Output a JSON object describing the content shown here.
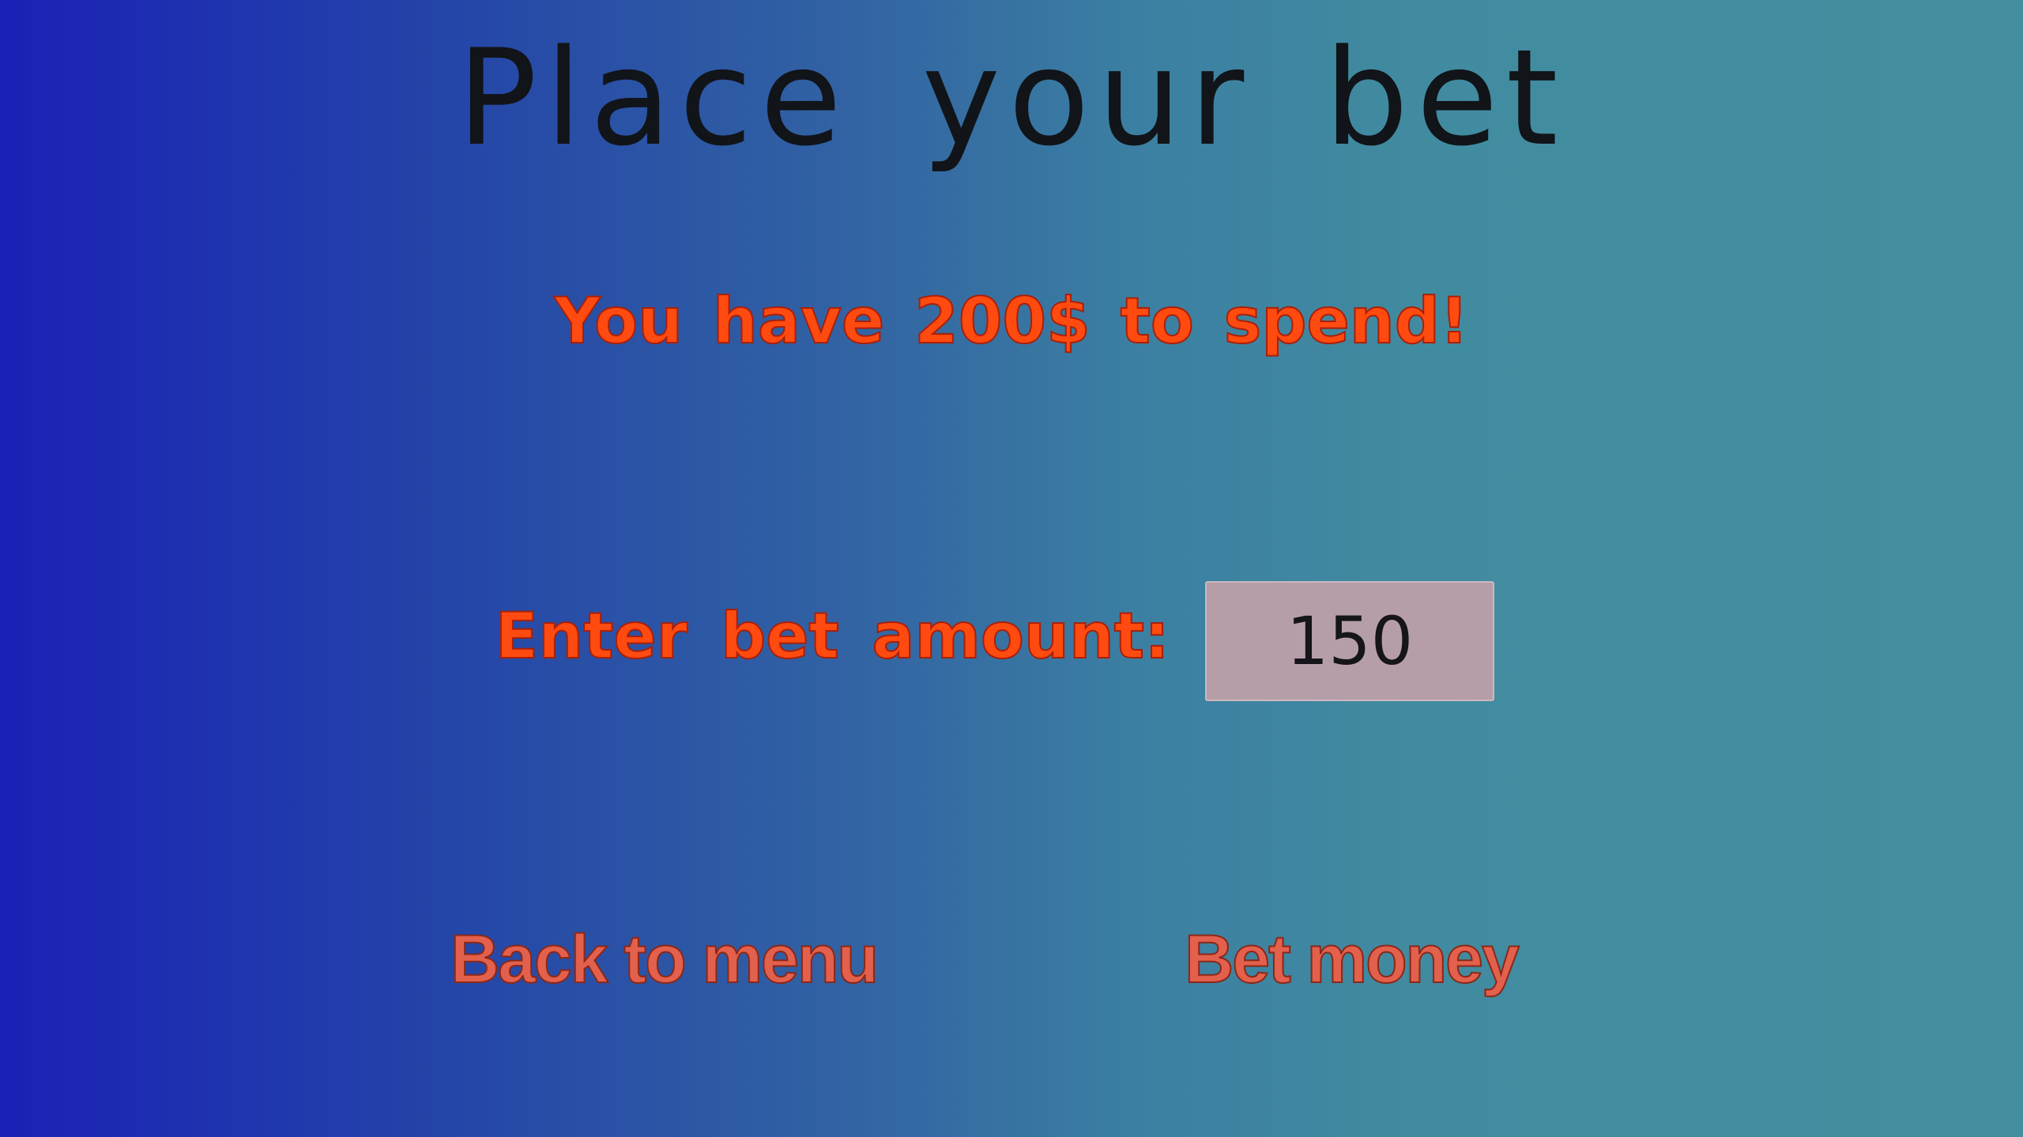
{
  "screen": {
    "title": "Place your bet",
    "balance_text": "You have 200$ to spend!",
    "bet_label": "Enter bet amount:",
    "bet_amount": "150",
    "back_button": "Back to menu",
    "bet_button": "Bet money"
  },
  "colors": {
    "background_left": "#1a21b6",
    "background_right": "#438f9f",
    "title": "#111418",
    "highlight_text": "#ff4a10",
    "button_text": "#e2604c",
    "input_background": "#b69ea8"
  }
}
